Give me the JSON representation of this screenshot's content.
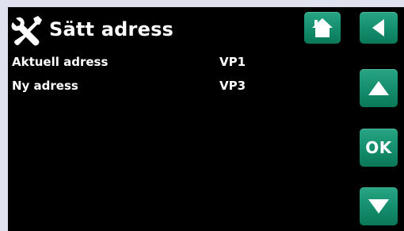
{
  "header": {
    "title": "Sätt adress",
    "icon": "tools-icon"
  },
  "rows": [
    {
      "label": "Aktuell adress",
      "value": "VP1"
    },
    {
      "label": "Ny adress",
      "value": "VP3"
    }
  ],
  "buttons": {
    "home": {
      "icon": "home-icon"
    },
    "back": {
      "icon": "back-arrow-icon"
    },
    "up": {
      "icon": "up-arrow-icon"
    },
    "ok": {
      "label": "OK"
    },
    "down": {
      "icon": "down-arrow-icon"
    }
  },
  "colors": {
    "screen_background": "#000000",
    "button_green": "#148d6d",
    "text": "#ffffff",
    "bezel": "#dfe2ee"
  }
}
